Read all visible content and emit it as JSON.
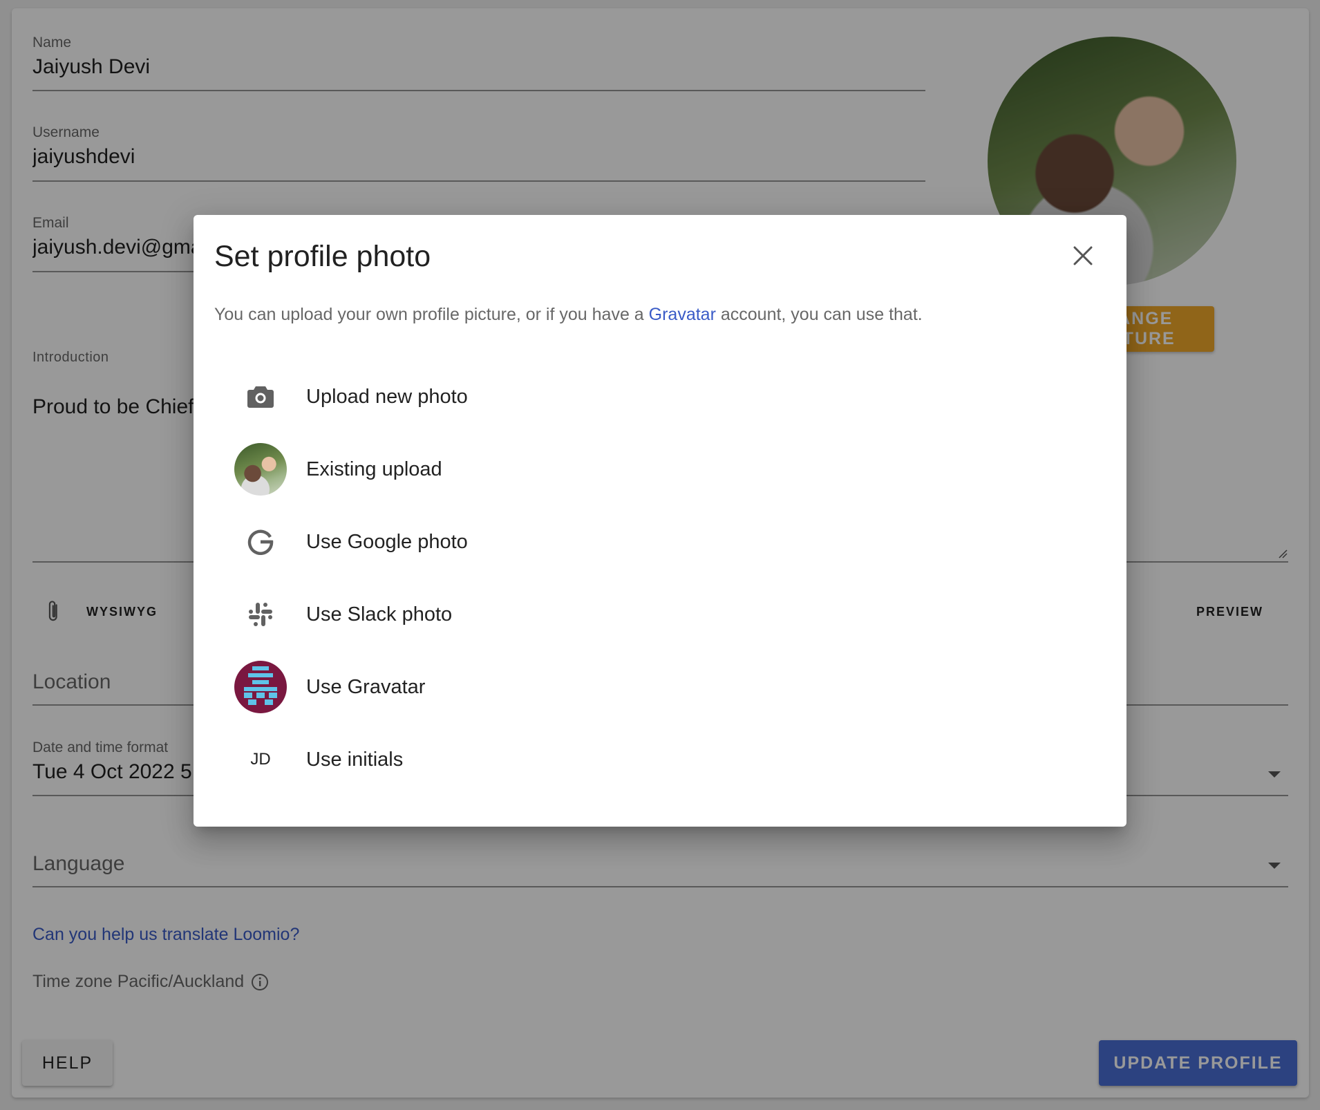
{
  "profile": {
    "name_label": "Name",
    "name_value": "Jaiyush Devi",
    "username_label": "Username",
    "username_value": "jaiyushdevi",
    "email_label": "Email",
    "email_value": "jaiyush.devi@gmail.com",
    "change_picture_label": "CHANGE PICTURE",
    "intro_label": "Introduction",
    "intro_value": "Proud to be Chief",
    "attach_icon": "paperclip-icon",
    "wysiwyg_label": "WYSIWYG",
    "preview_label": "PREVIEW",
    "location_placeholder": "Location",
    "date_format_label": "Date and time format",
    "date_format_value": "Tue 4 Oct 2022 5:",
    "language_placeholder": "Language",
    "translate_link": "Can you help us translate Loomio?",
    "timezone_text": "Time zone Pacific/Auckland",
    "help_label": "HELP",
    "update_label": "UPDATE PROFILE"
  },
  "dialog": {
    "title": "Set profile photo",
    "description_before": "You can upload your own profile picture, or if you have a ",
    "description_link": "Gravatar",
    "description_after": " account, you can use that.",
    "options": [
      {
        "label": "Upload new photo",
        "icon": "camera-icon"
      },
      {
        "label": "Existing upload",
        "icon": "existing-photo-avatar"
      },
      {
        "label": "Use Google photo",
        "icon": "google-icon"
      },
      {
        "label": "Use Slack photo",
        "icon": "slack-icon"
      },
      {
        "label": "Use Gravatar",
        "icon": "gravatar-avatar"
      },
      {
        "label": "Use initials",
        "icon": "initials-avatar",
        "initials": "JD"
      }
    ]
  },
  "colors": {
    "accent": "#f0a92a",
    "primary": "#4a6fd6",
    "link": "#3a5bc7",
    "gravatar_bg": "#7a1840",
    "gravatar_fg": "#5fc3e8"
  }
}
